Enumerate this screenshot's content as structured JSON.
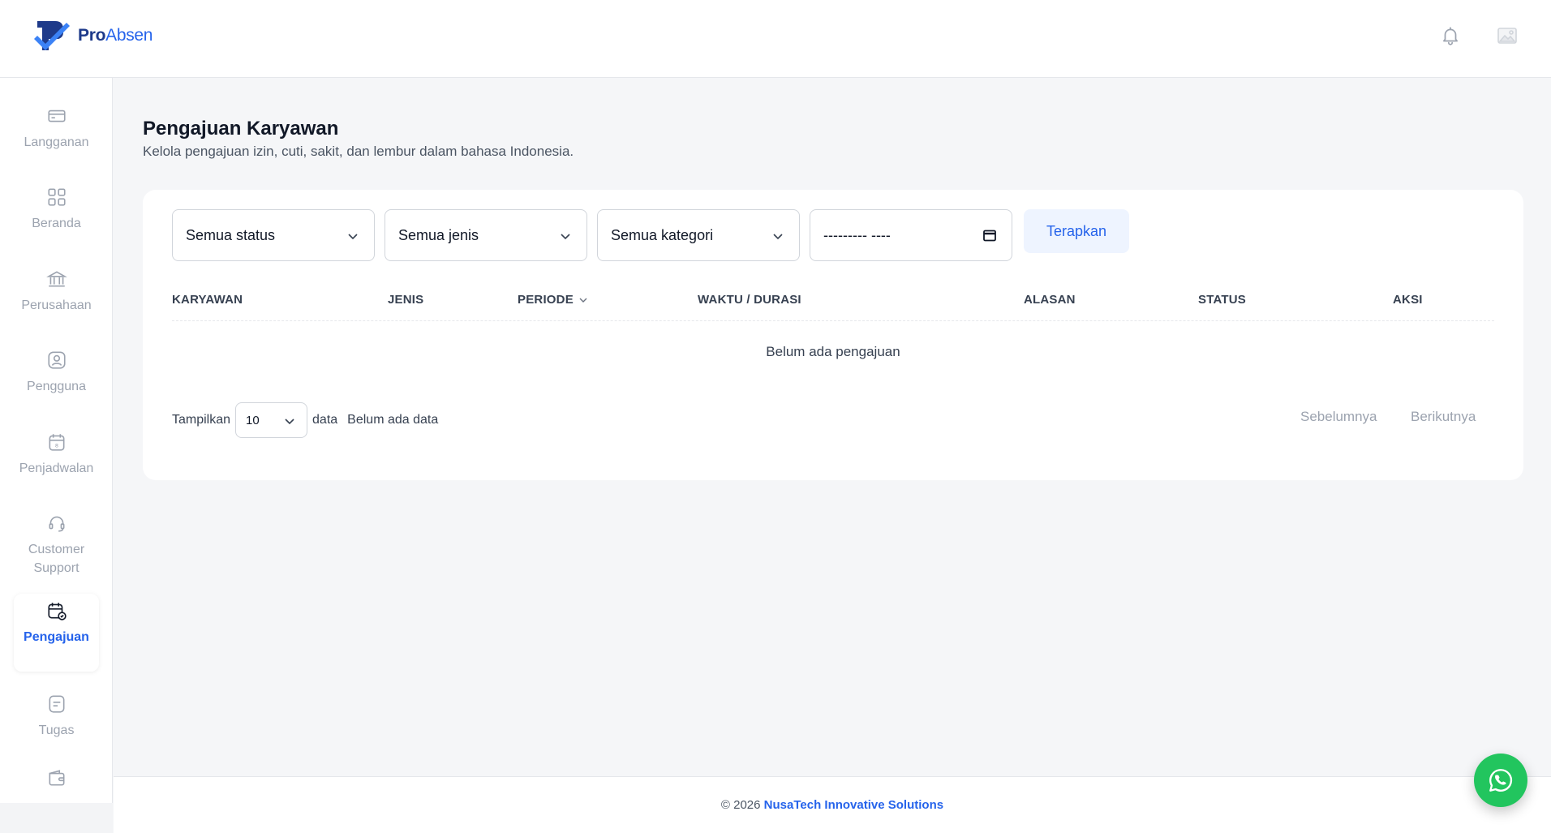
{
  "brand": {
    "name_pro": "Pro",
    "name_absen": "Absen",
    "primary_color": "#2563eb"
  },
  "header": {
    "notification_icon": "bell-icon",
    "profile_icon": "image-placeholder-icon"
  },
  "sidebar": {
    "items": [
      {
        "label": "Langganan",
        "icon": "credit-card-icon",
        "active": false
      },
      {
        "label": "Beranda",
        "icon": "grid-icon",
        "active": false
      },
      {
        "label": "Perusahaan",
        "icon": "bank-icon",
        "active": false
      },
      {
        "label": "Pengguna",
        "icon": "user-icon",
        "active": false
      },
      {
        "label": "Penjadwalan",
        "icon": "calendar-icon",
        "active": false
      },
      {
        "label": "Customer Support",
        "icon": "headset-icon",
        "active": false
      },
      {
        "label": "Pengajuan",
        "icon": "calendar-check-icon",
        "active": true
      },
      {
        "label": "Tugas",
        "icon": "task-icon",
        "active": false
      },
      {
        "label": "",
        "icon": "wallet-icon",
        "active": false
      }
    ]
  },
  "page": {
    "title": "Pengajuan Karyawan",
    "subtitle": "Kelola pengajuan izin, cuti, sakit, dan lembur dalam bahasa Indonesia."
  },
  "filters": {
    "status": "Semua status",
    "jenis": "Semua jenis",
    "kategori": "Semua kategori",
    "month_placeholder": "--------- ----",
    "apply_label": "Terapkan"
  },
  "table": {
    "columns": [
      "KARYAWAN",
      "JENIS",
      "PERIODE",
      "WAKTU / DURASI",
      "ALASAN",
      "STATUS",
      "AKSI"
    ],
    "empty_message": "Belum ada pengajuan"
  },
  "pagination": {
    "show_label": "Tampilkan",
    "per_page": "10",
    "data_label": "data",
    "info": "Belum ada data",
    "prev_label": "Sebelumnya",
    "next_label": "Berikutnya"
  },
  "footer": {
    "copyright": "© 2026",
    "company": "NusaTech Innovative Solutions"
  },
  "whatsapp": {
    "color": "#22c55e",
    "icon": "whatsapp-icon"
  }
}
